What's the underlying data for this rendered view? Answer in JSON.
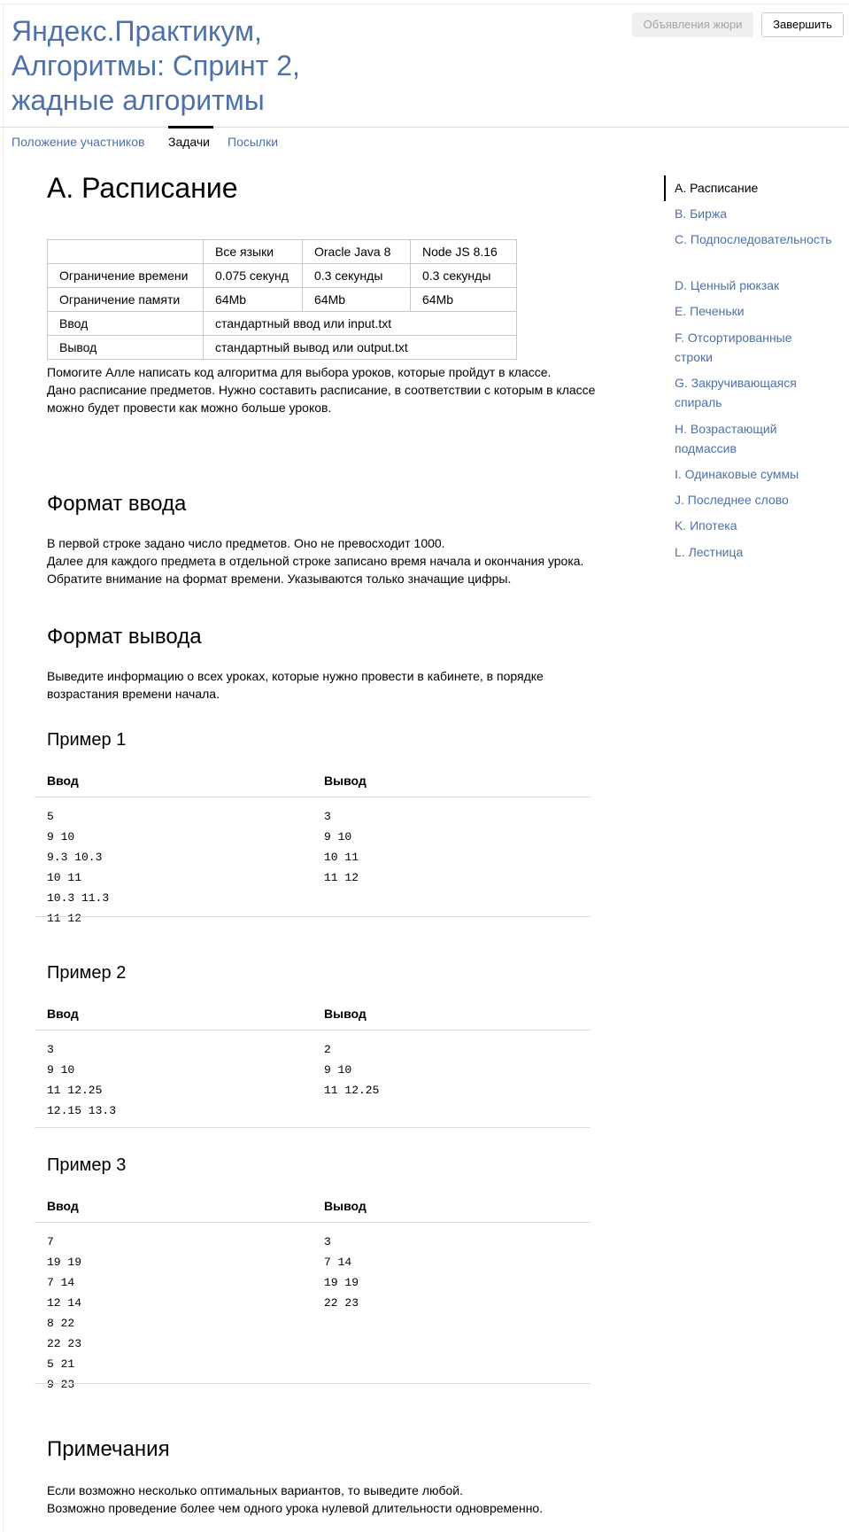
{
  "header": {
    "title_lines": [
      "Яндекс.Практикум,",
      "Алгоритмы: Спринт 2,",
      "жадные алгоритмы"
    ],
    "announce_button": "Объявления жюри",
    "finish_button": "Завершить"
  },
  "tabs": {
    "standings": "Положение участников",
    "tasks": "Задачи",
    "submits": "Посылки"
  },
  "problem": {
    "title": "А. Расписание",
    "limits": {
      "headers": [
        "Все языки",
        "Oracle Java 8",
        "Node JS 8.16"
      ],
      "time_label": "Ограничение времени",
      "time_values": [
        "0.075 секунд",
        "0.3 секунды",
        "0.3 секунды"
      ],
      "memory_label": "Ограничение памяти",
      "memory_values": [
        "64Mb",
        "64Mb",
        "64Mb"
      ],
      "input_label": "Ввод",
      "input_value": "стандартный ввод или input.txt",
      "output_label": "Вывод",
      "output_value": "стандартный вывод или output.txt"
    },
    "statement": [
      "Помогите Алле написать код алгоритма для выбора уроков, которые пройдут в классе.",
      "Дано расписание предметов. Нужно составить расписание, в соответствии с которым в классе",
      "можно будет провести как можно больше уроков."
    ],
    "input_format_title": "Формат ввода",
    "input_format": [
      "В первой строке задано число предметов. Оно не превосходит 1000.",
      "Далее для каждого предмета в отдельной строке записано время начала и окончания урока.",
      "Обратите внимание на формат времени. Указываются только значащие цифры."
    ],
    "output_format_title": "Формат вывода",
    "output_format": [
      "Выведите информацию о всех уроках, которые нужно провести в кабинете, в порядке",
      "возрастания времени начала."
    ],
    "examples": [
      {
        "title": "Пример 1",
        "input_label": "Ввод",
        "output_label": "Вывод",
        "input": [
          "5",
          "9 10",
          "9.3 10.3",
          "10 11",
          "10.3 11.3",
          "11 12"
        ],
        "output": [
          "3",
          "9 10",
          "10 11",
          "11 12"
        ]
      },
      {
        "title": "Пример 2",
        "input_label": "Ввод",
        "output_label": "Вывод",
        "input": [
          "3",
          "9 10",
          "11 12.25",
          "12.15 13.3"
        ],
        "output": [
          "2",
          "9 10",
          "11 12.25"
        ]
      },
      {
        "title": "Пример 3",
        "input_label": "Ввод",
        "output_label": "Вывод",
        "input": [
          "7",
          "19 19",
          "7 14",
          "12 14",
          "8 22",
          "22 23",
          "5 21",
          "9 23"
        ],
        "output": [
          "3",
          "7 14",
          "19 19",
          "22 23"
        ]
      }
    ],
    "notes_title": "Примечания",
    "notes": [
      "Если возможно несколько оптимальных вариантов, то выведите любой.",
      "Возможно проведение более чем одного урока нулевой длительности одновременно."
    ]
  },
  "toc": {
    "items": [
      {
        "label": "A. Расписание",
        "active": true
      },
      {
        "label": "B. Биржа",
        "active": false
      },
      {
        "label": "C. Подпоследовательность",
        "active": false
      },
      {
        "label": "D. Ценный рюкзак",
        "active": false
      },
      {
        "label": "E. Печеньки",
        "active": false
      },
      {
        "label": "F. Отсортированные строки",
        "active": false
      },
      {
        "label": "G. Закручивающаяся спираль",
        "active": false
      },
      {
        "label": "H. Возрастающий подмассив",
        "active": false
      },
      {
        "label": "I. Одинаковые суммы",
        "active": false
      },
      {
        "label": "J. Последнее слово",
        "active": false
      },
      {
        "label": "K. Ипотека",
        "active": false
      },
      {
        "label": "L. Лестница",
        "active": false
      }
    ]
  },
  "colors": {
    "link": "#4d71a8",
    "border": "#c8c8c8",
    "header_cell_bg": "#f2f2f2"
  }
}
